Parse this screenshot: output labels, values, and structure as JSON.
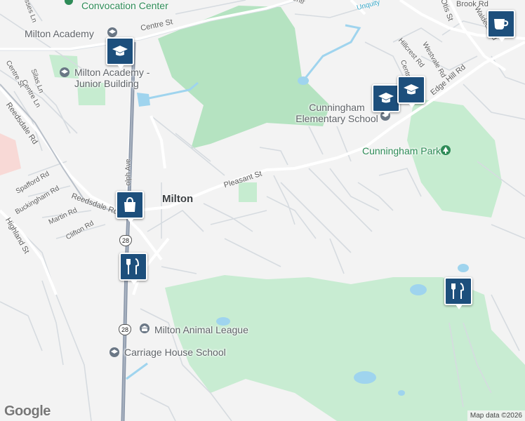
{
  "map": {
    "places": {
      "convocation": "Convocation Center",
      "academy": "Milton Academy",
      "academy_junior": "Milton Academy - Junior Building",
      "cunningham_school": "Cunningham Elementary School",
      "cunningham_park": "Cunningham Park",
      "animal_league": "Milton Animal League",
      "carriage_house": "Carriage House School",
      "town": "Milton"
    },
    "streets": {
      "centre_st": "Centre St",
      "centre_st_left": "Centre St",
      "centre_ln": "Centre Ln",
      "silas_ln": "Silas Ln",
      "sasses_ln": "sses Ln",
      "reedsdale_rd": "Reedsdale Rd",
      "reedsdale_rd_lower": "Reedsdale Rd",
      "spafford_rd": "Spafford Rd",
      "buckingham_rd": "Buckingham Rd",
      "martin_rd": "Martin Rd",
      "clifton_rd": "Clifton Rd",
      "highland_st": "Highland St",
      "randolph_ave": "olph Ave",
      "pleasant_st": "Pleasant St",
      "edge_hill_rd": "Edge Hill Rd",
      "hillcrest_rd": "Hillcrest Rd",
      "westvale_rd": "Westvale Rd",
      "centre_partial": "Centr",
      "otis_st": "Otis St",
      "brook_rd": "Brook Rd",
      "waldeck_rd": "Waldeck Rd",
      "unquity": "Unquity",
      "centre_top": "Centr"
    },
    "route_shields": [
      "28",
      "28"
    ],
    "attribution": "Map data ©2026",
    "logo": "Google",
    "marker_icons": [
      "graduation-cap-icon",
      "graduation-cap-icon",
      "graduation-cap-icon",
      "shopping-bag-icon",
      "restaurant-icon",
      "restaurant-icon",
      "coffee-cup-icon"
    ],
    "colors": {
      "park": "#b7e4c2",
      "golf": "#c8ecd2",
      "water": "#9fd4ee",
      "highway": "#8a96a8",
      "marker": "#1d4f7c",
      "poi_green": "#2e8b57"
    }
  }
}
